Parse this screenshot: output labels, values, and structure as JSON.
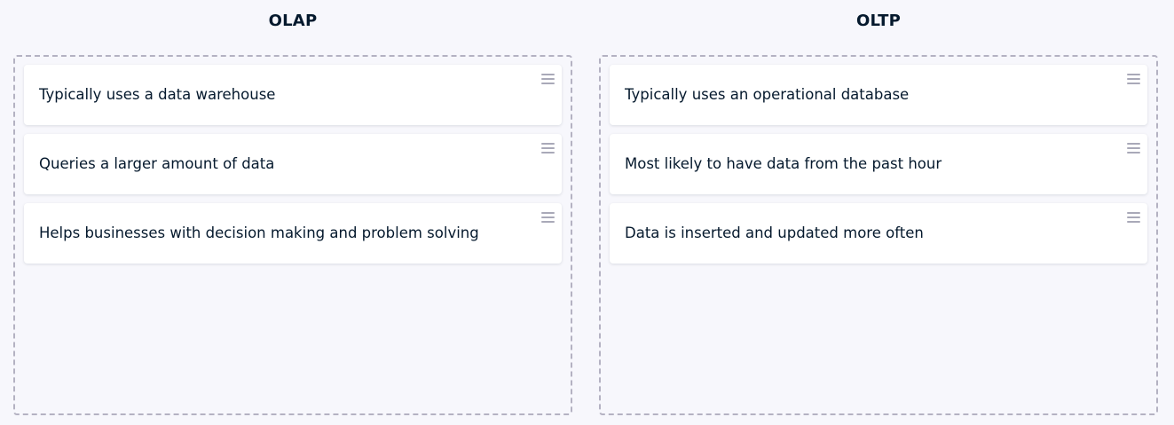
{
  "columns": [
    {
      "title": "OLAP",
      "cards": [
        {
          "text": "Typically uses a data warehouse"
        },
        {
          "text": "Queries a larger amount of data"
        },
        {
          "text": "Helps businesses with decision making and problem solving"
        }
      ]
    },
    {
      "title": "OLTP",
      "cards": [
        {
          "text": "Typically uses an operational database"
        },
        {
          "text": "Most likely to have data from the past hour"
        },
        {
          "text": "Data is inserted and updated more often"
        }
      ]
    }
  ],
  "icons": {
    "handle": "drag-handle-icon"
  },
  "colors": {
    "background": "#f7f7fc",
    "text": "#05192d",
    "dropzone_border": "#b4b2c2",
    "card": "#ffffff",
    "handle": "#a9a9b8"
  }
}
